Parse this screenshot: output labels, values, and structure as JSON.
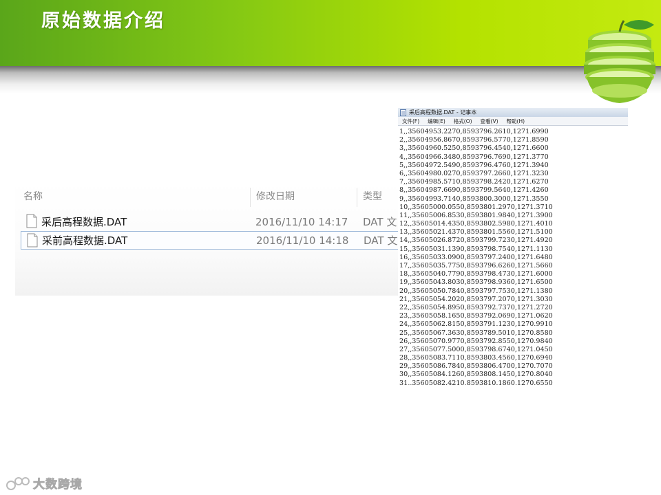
{
  "slide": {
    "title": "原始数据介绍"
  },
  "explorer": {
    "columns": {
      "name": "名称",
      "modified": "修改日期",
      "type": "类型"
    },
    "files": [
      {
        "name": "采后高程数据.DAT",
        "modified": "2016/11/10 14:17",
        "type": "DAT 文",
        "selected": false
      },
      {
        "name": "采前高程数据.DAT",
        "modified": "2016/11/10 14:18",
        "type": "DAT 文",
        "selected": true
      }
    ]
  },
  "notepad": {
    "title": "采后高程数据.DAT - 记事本",
    "menu": [
      "文件(F)",
      "编辑(E)",
      "格式(O)",
      "查看(V)",
      "帮助(H)"
    ],
    "lines": [
      "1,,35604953.2270,8593796.2610,1271.6990",
      "2,,35604956.8670,8593796.5770,1271.8590",
      "3,,35604960.5250,8593796.4540,1271.6600",
      "4,,35604966.3480,8593796.7690,1271.3770",
      "5,,35604972.5490,8593796.4760,1271.3940",
      "6,,35604980.0270,8593797.2660,1271.3230",
      "7,,35604985.5710,8593798.2420,1271.6270",
      "8,,35604987.6690,8593799.5640,1271.4260",
      "9,,35604993.7140,8593800.3000,1271.3550",
      "10,,35605000.0550,8593801.2970,1271.3710",
      "11,,35605006.8530,8593801.9840,1271.3900",
      "12,,35605014.4350,8593802.5980,1271.4010",
      "13,,35605021.4370,8593801.5560,1271.5100",
      "14,,35605026.8720,8593799.7230,1271.4920",
      "15,,35605031.1390,8593798.7540,1271.1130",
      "16,,35605033.0900,8593797.2400,1271.6480",
      "17,,35605035.7750,8593796.6260,1271.5660",
      "18,,35605040.7790,8593798.4730,1271.6000",
      "19,,35605043.8030,8593798.9360,1271.6500",
      "20,,35605050.7840,8593797.7530,1271.1380",
      "21,,35605054.2020,8593797.2070,1271.3030",
      "22,,35605054.8950,8593792.7370,1271.2720",
      "23,,35605058.1650,8593792.0690,1271.0620",
      "24,,35605062.8150,8593791.1230,1270.9910",
      "25,,35605067.3630,8593789.5010,1270.8580",
      "26,,35605070.9770,8593792.8550,1270.9840",
      "27,,35605077.5000,8593798.6740,1271.0450",
      "28,,35605083.7110,8593803.4560,1270.6940",
      "29,,35605086.7840,8593806.4700,1270.7070",
      "30,,35605084.1260,8593808.1450,1270.8040",
      "31,,35605082.4210,8593810.1860,1270.6550"
    ]
  },
  "watermark": {
    "text": "大数跨境"
  },
  "colors": {
    "banner_left": "#5aa61a",
    "banner_right": "#c4ea10",
    "selection_border": "#9ab6d8"
  },
  "icons": [
    "file-icon",
    "notepad-app-icon",
    "apple-decoration",
    "watermark-logo"
  ]
}
